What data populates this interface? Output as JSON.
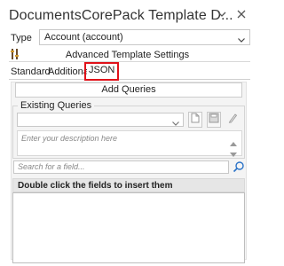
{
  "window": {
    "title": "DocumentsCorePack Template D...",
    "chevron_icon": "chevron-down-icon",
    "close_icon": "close-icon"
  },
  "type_field": {
    "label": "Type",
    "value": "Account (account)"
  },
  "advanced": {
    "label": "Advanced Template Settings",
    "icon": "settings-icon"
  },
  "tabs": [
    {
      "label": "Standard"
    },
    {
      "label": "Additional"
    },
    {
      "label": "JSON",
      "selected": true,
      "highlight_color": "#e0121a"
    }
  ],
  "json_panel": {
    "add_queries_label": "Add Queries",
    "existing_queries_label": "Existing Queries",
    "query_select_value": "",
    "description_placeholder": "Enter your description here",
    "search_placeholder": "Search for a field...",
    "fields_header": "Double click the fields to insert them",
    "fields": []
  }
}
